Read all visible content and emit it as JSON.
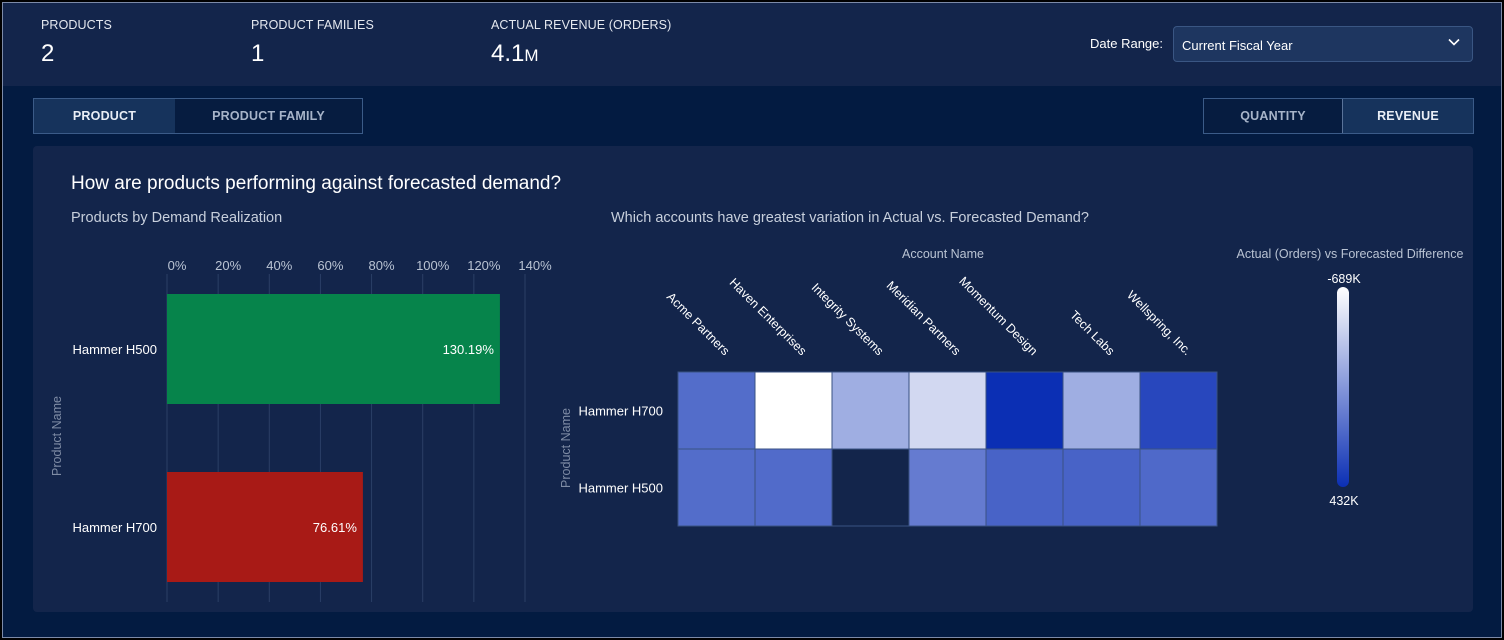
{
  "kpis": [
    {
      "label": "PRODUCTS",
      "value": "2",
      "unit": ""
    },
    {
      "label": "PRODUCT FAMILIES",
      "value": "1",
      "unit": ""
    },
    {
      "label": "ACTUAL REVENUE (ORDERS)",
      "value": "4.1",
      "unit": "M"
    }
  ],
  "date_range": {
    "label": "Date Range:",
    "value": "Current Fiscal Year",
    "icon": "chevron-down-icon"
  },
  "view_toggle": {
    "options": [
      {
        "label": "PRODUCT",
        "active": true
      },
      {
        "label": "PRODUCT FAMILY",
        "active": false
      }
    ]
  },
  "measure_toggle": {
    "options": [
      {
        "label": "QUANTITY",
        "active": false
      },
      {
        "label": "REVENUE",
        "active": true
      }
    ]
  },
  "panel": {
    "title": "How are products performing against forecasted demand?"
  },
  "chart_data": [
    {
      "type": "bar",
      "orientation": "horizontal",
      "title": "Products by Demand Realization",
      "ylabel": "Product Name",
      "xlabel": "",
      "categories": [
        "Hammer H500",
        "Hammer H700"
      ],
      "values": [
        130.19,
        76.61
      ],
      "value_labels": [
        "130.19%",
        "76.61%"
      ],
      "colors": [
        "#06844b",
        "#a81a16"
      ],
      "xlim": [
        0,
        140
      ],
      "xticks": [
        0,
        20,
        40,
        60,
        80,
        100,
        120,
        140
      ],
      "xtick_labels": [
        "0%",
        "20%",
        "40%",
        "60%",
        "80%",
        "100%",
        "120%",
        "140%"
      ],
      "x_axis_position": "top",
      "grid": true
    },
    {
      "type": "heatmap",
      "title": "Which accounts have greatest variation in Actual vs. Forecasted Demand?",
      "xlabel": "Account Name",
      "ylabel": "Product Name",
      "x_axis_position": "top",
      "x": [
        "Acme Partners",
        "Haven Enterprises",
        "Integrity Systems",
        "Meridian Partners",
        "Momentum Design",
        "Tech Labs",
        "Wellspring, Inc."
      ],
      "y": [
        "Hammer H700",
        "Hammer H500"
      ],
      "values": [
        [
          100000,
          -689000,
          -250000,
          -480000,
          432000,
          -250000,
          300000
        ],
        [
          100000,
          110000,
          null,
          20000,
          150000,
          150000,
          120000
        ]
      ],
      "color_scale": {
        "title": "Actual (Orders) vs Forecasted Difference",
        "min": -689000,
        "max": 432000,
        "min_label": "-689K",
        "max_label": "432K",
        "min_color": "#ffffff",
        "max_color": "#0b2fb4"
      },
      "missing_color": "#13254b"
    }
  ]
}
